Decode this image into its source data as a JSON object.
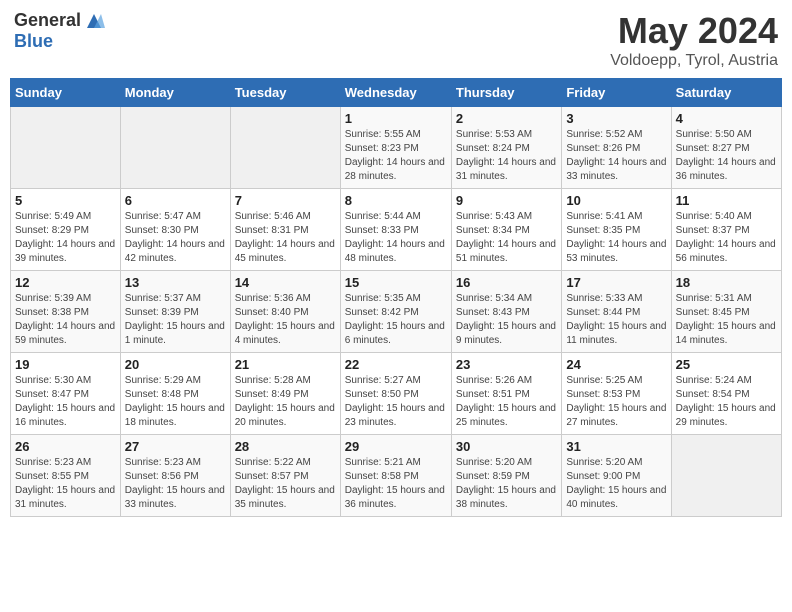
{
  "header": {
    "logo_general": "General",
    "logo_blue": "Blue",
    "month_title": "May 2024",
    "location": "Voldoepp, Tyrol, Austria"
  },
  "weekdays": [
    "Sunday",
    "Monday",
    "Tuesday",
    "Wednesday",
    "Thursday",
    "Friday",
    "Saturday"
  ],
  "weeks": [
    [
      {
        "day": "",
        "info": ""
      },
      {
        "day": "",
        "info": ""
      },
      {
        "day": "",
        "info": ""
      },
      {
        "day": "1",
        "info": "Sunrise: 5:55 AM\nSunset: 8:23 PM\nDaylight: 14 hours and 28 minutes."
      },
      {
        "day": "2",
        "info": "Sunrise: 5:53 AM\nSunset: 8:24 PM\nDaylight: 14 hours and 31 minutes."
      },
      {
        "day": "3",
        "info": "Sunrise: 5:52 AM\nSunset: 8:26 PM\nDaylight: 14 hours and 33 minutes."
      },
      {
        "day": "4",
        "info": "Sunrise: 5:50 AM\nSunset: 8:27 PM\nDaylight: 14 hours and 36 minutes."
      }
    ],
    [
      {
        "day": "5",
        "info": "Sunrise: 5:49 AM\nSunset: 8:29 PM\nDaylight: 14 hours and 39 minutes."
      },
      {
        "day": "6",
        "info": "Sunrise: 5:47 AM\nSunset: 8:30 PM\nDaylight: 14 hours and 42 minutes."
      },
      {
        "day": "7",
        "info": "Sunrise: 5:46 AM\nSunset: 8:31 PM\nDaylight: 14 hours and 45 minutes."
      },
      {
        "day": "8",
        "info": "Sunrise: 5:44 AM\nSunset: 8:33 PM\nDaylight: 14 hours and 48 minutes."
      },
      {
        "day": "9",
        "info": "Sunrise: 5:43 AM\nSunset: 8:34 PM\nDaylight: 14 hours and 51 minutes."
      },
      {
        "day": "10",
        "info": "Sunrise: 5:41 AM\nSunset: 8:35 PM\nDaylight: 14 hours and 53 minutes."
      },
      {
        "day": "11",
        "info": "Sunrise: 5:40 AM\nSunset: 8:37 PM\nDaylight: 14 hours and 56 minutes."
      }
    ],
    [
      {
        "day": "12",
        "info": "Sunrise: 5:39 AM\nSunset: 8:38 PM\nDaylight: 14 hours and 59 minutes."
      },
      {
        "day": "13",
        "info": "Sunrise: 5:37 AM\nSunset: 8:39 PM\nDaylight: 15 hours and 1 minute."
      },
      {
        "day": "14",
        "info": "Sunrise: 5:36 AM\nSunset: 8:40 PM\nDaylight: 15 hours and 4 minutes."
      },
      {
        "day": "15",
        "info": "Sunrise: 5:35 AM\nSunset: 8:42 PM\nDaylight: 15 hours and 6 minutes."
      },
      {
        "day": "16",
        "info": "Sunrise: 5:34 AM\nSunset: 8:43 PM\nDaylight: 15 hours and 9 minutes."
      },
      {
        "day": "17",
        "info": "Sunrise: 5:33 AM\nSunset: 8:44 PM\nDaylight: 15 hours and 11 minutes."
      },
      {
        "day": "18",
        "info": "Sunrise: 5:31 AM\nSunset: 8:45 PM\nDaylight: 15 hours and 14 minutes."
      }
    ],
    [
      {
        "day": "19",
        "info": "Sunrise: 5:30 AM\nSunset: 8:47 PM\nDaylight: 15 hours and 16 minutes."
      },
      {
        "day": "20",
        "info": "Sunrise: 5:29 AM\nSunset: 8:48 PM\nDaylight: 15 hours and 18 minutes."
      },
      {
        "day": "21",
        "info": "Sunrise: 5:28 AM\nSunset: 8:49 PM\nDaylight: 15 hours and 20 minutes."
      },
      {
        "day": "22",
        "info": "Sunrise: 5:27 AM\nSunset: 8:50 PM\nDaylight: 15 hours and 23 minutes."
      },
      {
        "day": "23",
        "info": "Sunrise: 5:26 AM\nSunset: 8:51 PM\nDaylight: 15 hours and 25 minutes."
      },
      {
        "day": "24",
        "info": "Sunrise: 5:25 AM\nSunset: 8:53 PM\nDaylight: 15 hours and 27 minutes."
      },
      {
        "day": "25",
        "info": "Sunrise: 5:24 AM\nSunset: 8:54 PM\nDaylight: 15 hours and 29 minutes."
      }
    ],
    [
      {
        "day": "26",
        "info": "Sunrise: 5:23 AM\nSunset: 8:55 PM\nDaylight: 15 hours and 31 minutes."
      },
      {
        "day": "27",
        "info": "Sunrise: 5:23 AM\nSunset: 8:56 PM\nDaylight: 15 hours and 33 minutes."
      },
      {
        "day": "28",
        "info": "Sunrise: 5:22 AM\nSunset: 8:57 PM\nDaylight: 15 hours and 35 minutes."
      },
      {
        "day": "29",
        "info": "Sunrise: 5:21 AM\nSunset: 8:58 PM\nDaylight: 15 hours and 36 minutes."
      },
      {
        "day": "30",
        "info": "Sunrise: 5:20 AM\nSunset: 8:59 PM\nDaylight: 15 hours and 38 minutes."
      },
      {
        "day": "31",
        "info": "Sunrise: 5:20 AM\nSunset: 9:00 PM\nDaylight: 15 hours and 40 minutes."
      },
      {
        "day": "",
        "info": ""
      }
    ]
  ]
}
